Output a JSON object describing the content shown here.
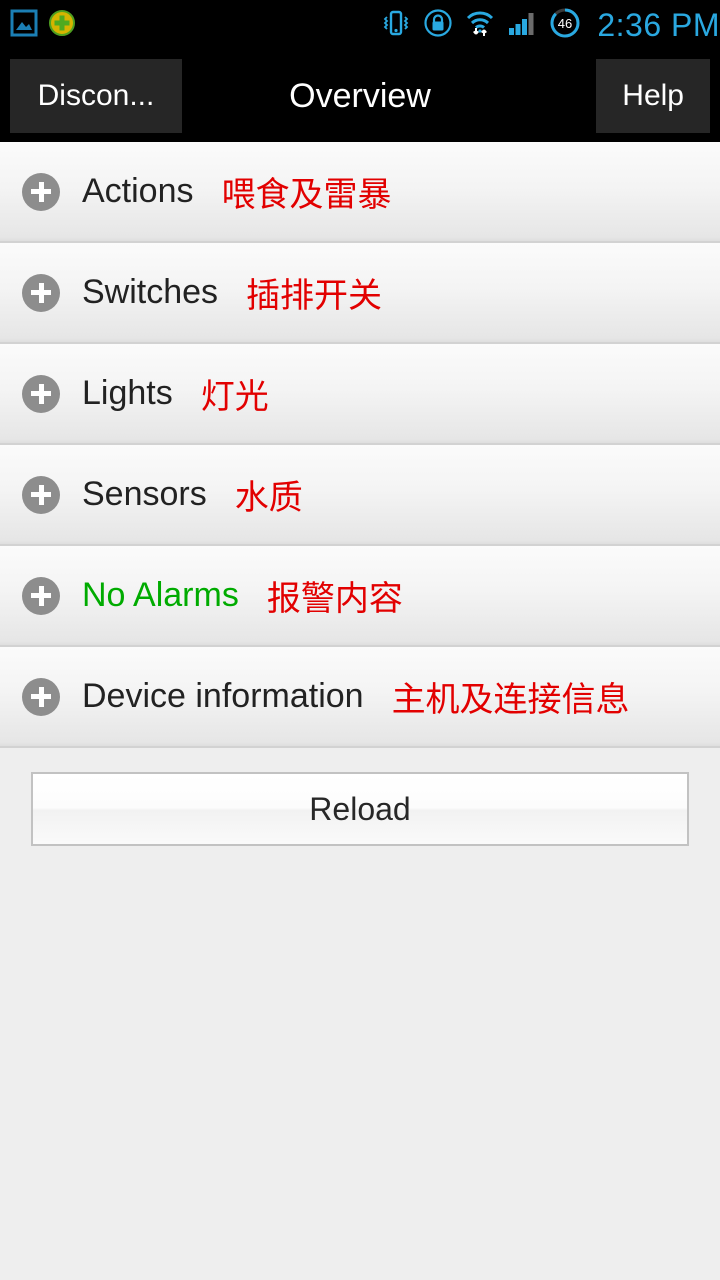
{
  "status_bar": {
    "notifications": [
      {
        "name": "gallery-image-icon"
      },
      {
        "name": "app-update-icon"
      }
    ],
    "system_icons": [
      {
        "name": "vibrate-icon"
      },
      {
        "name": "screen-lock-icon"
      },
      {
        "name": "wifi-data-icon"
      },
      {
        "name": "signal-bars-icon"
      },
      {
        "name": "battery-icon"
      }
    ],
    "battery_level": "46",
    "clock": "2:36 PM",
    "clock_color": "#2aa8e0"
  },
  "action_bar": {
    "disconnect_label": "Discon...",
    "title": "Overview",
    "help_label": "Help"
  },
  "list": {
    "rows": [
      {
        "icon": "plus-circle-icon",
        "label": "Actions",
        "sub": "喂食及雷暴",
        "state": "normal"
      },
      {
        "icon": "plus-circle-icon",
        "label": "Switches",
        "sub": "插排开关",
        "state": "normal"
      },
      {
        "icon": "plus-circle-icon",
        "label": "Lights",
        "sub": "灯光",
        "state": "normal"
      },
      {
        "icon": "plus-circle-icon",
        "label": "Sensors",
        "sub": "水质",
        "state": "normal"
      },
      {
        "icon": "plus-circle-icon",
        "label": "No Alarms",
        "sub": "报警内容",
        "state": "ok"
      },
      {
        "icon": "plus-circle-icon",
        "label": "Device information",
        "sub": "主机及连接信息",
        "state": "normal"
      }
    ]
  },
  "footer": {
    "reload_label": "Reload"
  },
  "colors": {
    "label": "#222222",
    "sub": "#e20000",
    "ok": "#00ab00",
    "background": "#eeeeee",
    "bar": "#000000"
  }
}
